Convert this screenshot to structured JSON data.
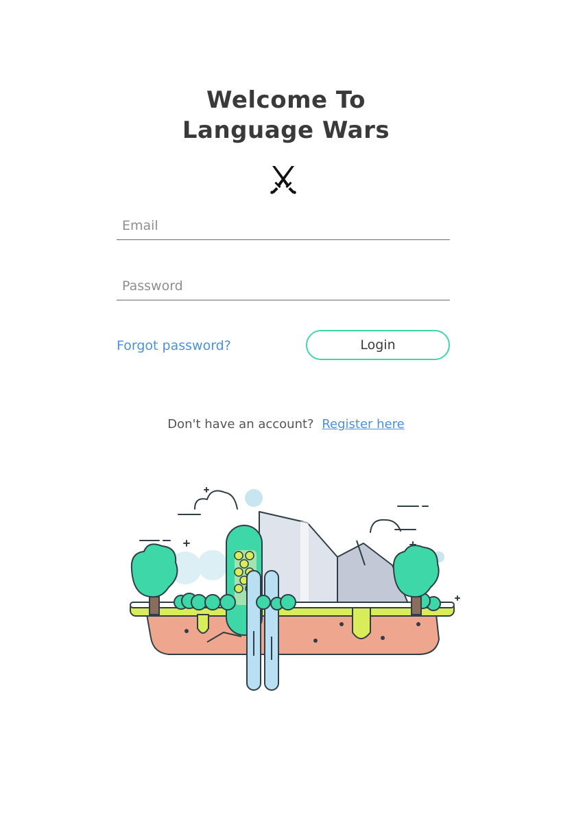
{
  "title": {
    "line1": "Welcome To",
    "line2": "Language Wars"
  },
  "logo": {
    "icon": "crossed-swords-icon"
  },
  "form": {
    "email_placeholder": "Email",
    "password_placeholder": "Password",
    "forgot_label": "Forgot password?",
    "login_label": "Login"
  },
  "register": {
    "question": "Don't have an account?",
    "link_label": "Register here"
  },
  "colors": {
    "heading": "#3a3a3a",
    "link": "#4a90e2",
    "button_border": "#3ed8a8",
    "illustration_green": "#3ed8a8",
    "illustration_lime": "#d9ec5a",
    "illustration_ground": "#eea68e"
  },
  "illustration": {
    "icon": "floating-island-illustration"
  }
}
